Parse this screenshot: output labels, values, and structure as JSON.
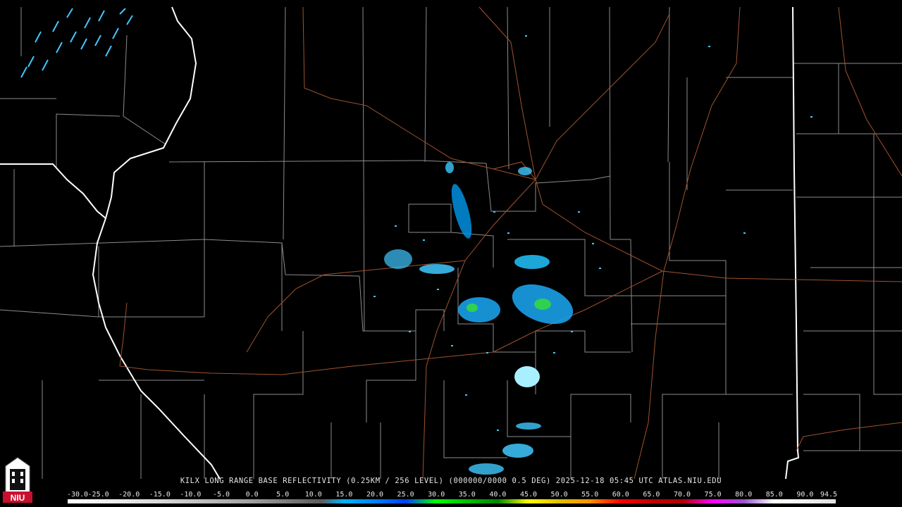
{
  "title": "KILX LONG RANGE BASE REFLECTIVITY (0.25KM / 256 LEVEL) (000000/0000 0.5 DEG) 2025-12-18 05:45 UTC  ATLAS.NIU.EDU",
  "scale_labels": [
    "-30.0",
    "-25.0",
    "-20.0",
    "-15.0",
    "-10.0",
    "-5.0",
    "0.0",
    "5.0",
    "10.0",
    "15.0",
    "20.0",
    "25.0",
    "30.0",
    "35.0",
    "40.0",
    "45.0",
    "50.0",
    "55.0",
    "60.0",
    "65.0",
    "70.0",
    "75.0",
    "80.0",
    "85.0",
    "90.0",
    "94.5"
  ],
  "logo_text": "NIU",
  "colors": {
    "background": "#000000",
    "state_border": "#ffffff",
    "county_border": "#8c8c8c",
    "highway": "#a0522d",
    "echo_light": "#40c8ff",
    "echo_mid": "#00a0e0",
    "echo_green": "#30d050"
  }
}
